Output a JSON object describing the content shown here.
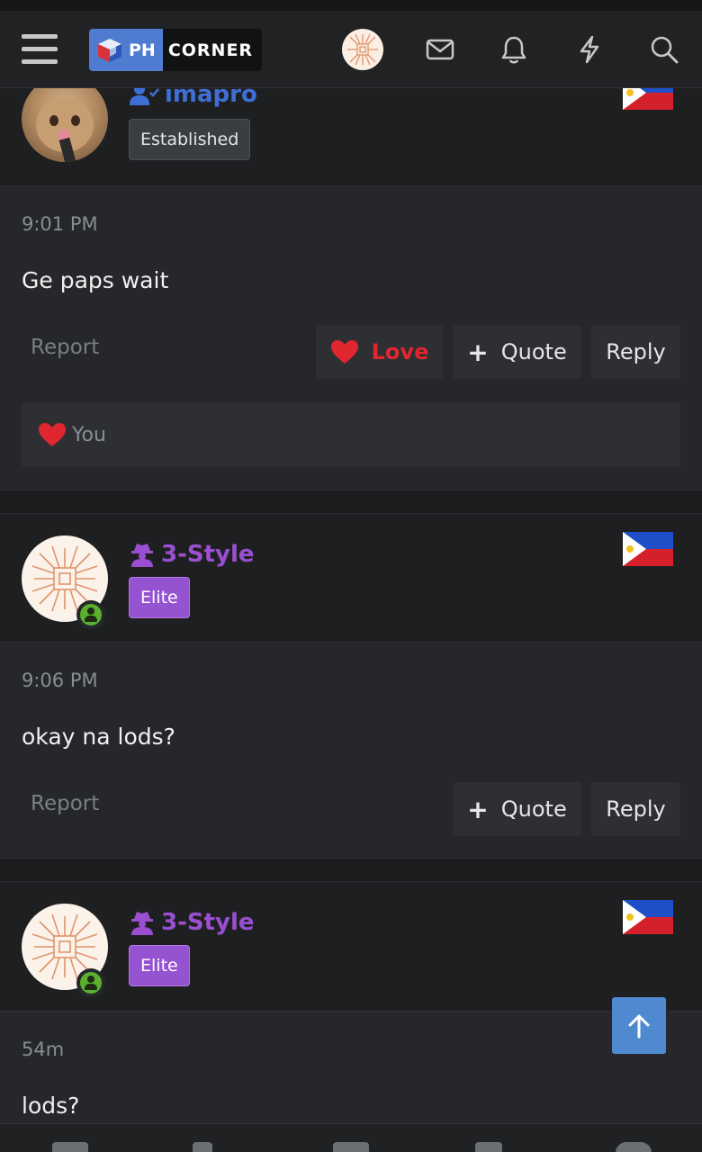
{
  "header": {
    "logo_ph": "PH",
    "logo_corner": "CORNER",
    "icons": [
      "menu-icon",
      "user-avatar",
      "mail-icon",
      "bell-icon",
      "bolt-icon",
      "search-icon"
    ]
  },
  "posts": [
    {
      "username": "imapro",
      "badge": "Established",
      "time": "9:01 PM",
      "message": "Ge paps wait",
      "report": "Report",
      "love_label": "Love",
      "quote_label": "Quote",
      "reply_label": "Reply",
      "reaction_user": "You"
    },
    {
      "username": "3-Style",
      "badge": "Elite",
      "time": "9:06 PM",
      "message": "okay na lods?",
      "report": "Report",
      "quote_label": "Quote",
      "reply_label": "Reply"
    },
    {
      "username": "3-Style",
      "badge": "Elite",
      "time": "54m",
      "message": "lods?"
    }
  ],
  "colors": {
    "accent_blue": "#3f6fd6",
    "elite_purple": "#9552d1",
    "love_red": "#e0262f",
    "online_green": "#5bb02f",
    "scroll_top_blue": "#4f8ad0"
  }
}
